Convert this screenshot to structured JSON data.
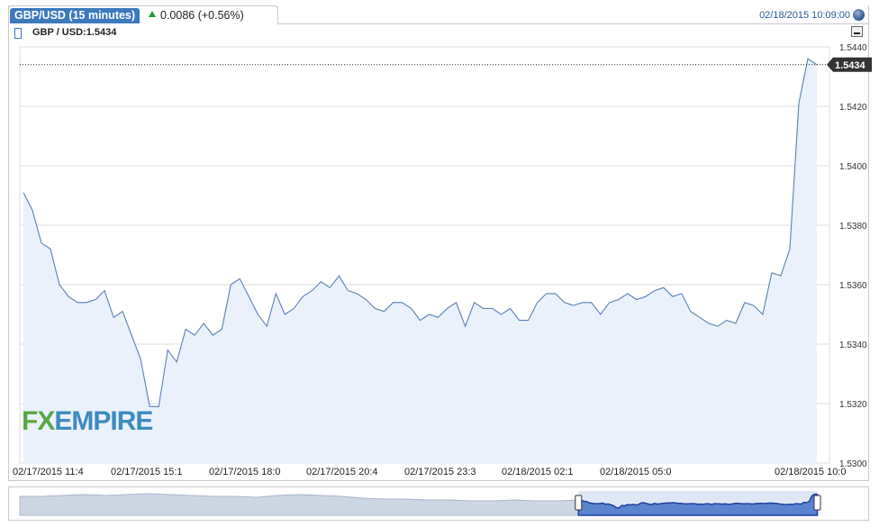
{
  "header": {
    "tab_title": "GBP/USD (15 minutes)",
    "change": "0.0086 (+0.56%)",
    "timestamp": "02/18/2015 10:09:00"
  },
  "legend": {
    "label": "GBP / USD:1.5434"
  },
  "brand": {
    "logo_text": "FXEMPIRE"
  },
  "colors": {
    "accent": "#3c79bd",
    "line": "#5a80b5",
    "fill": "#eaf1fb",
    "up": "#1f9a38",
    "logo_green": "#5aa647",
    "logo_blue": "#3d8bbf"
  },
  "chart_data": {
    "type": "area",
    "title": "",
    "current_price_label": "1.5434",
    "ylim": [
      1.53,
      1.544
    ],
    "yticks": [
      "1.5440",
      "1.5420",
      "1.5400",
      "1.5380",
      "1.5360",
      "1.5340",
      "1.5320",
      "1.5300"
    ],
    "xticks": [
      "02/17/2015 11:4",
      "02/17/2015 15:1",
      "02/17/2015 18:0",
      "02/17/2015 20:4",
      "02/17/2015 23:3",
      "02/18/2015 02:1",
      "02/18/2015 05:0",
      "02/18/2015 10:0"
    ],
    "series": [
      {
        "values": [
          1.5391,
          1.5385,
          1.5374,
          1.5372,
          1.536,
          1.5356,
          1.5354,
          1.5354,
          1.5355,
          1.5358,
          1.5349,
          1.5351,
          1.5343,
          1.5335,
          1.5319,
          1.5319,
          1.5338,
          1.5334,
          1.5345,
          1.5343,
          1.5347,
          1.5343,
          1.5345,
          1.536,
          1.5362,
          1.5356,
          1.535,
          1.5346,
          1.5357,
          1.535,
          1.5352,
          1.5356,
          1.5358,
          1.5361,
          1.5359,
          1.5363,
          1.5358,
          1.5357,
          1.5355,
          1.5352,
          1.5351,
          1.5354,
          1.5354,
          1.5352,
          1.5348,
          1.535,
          1.5349,
          1.5352,
          1.5354,
          1.5346,
          1.5354,
          1.5352,
          1.5352,
          1.535,
          1.5352,
          1.5348,
          1.5348,
          1.5354,
          1.5357,
          1.5357,
          1.5354,
          1.5353,
          1.5354,
          1.5354,
          1.535,
          1.5354,
          1.5355,
          1.5357,
          1.5355,
          1.5356,
          1.5358,
          1.5359,
          1.5356,
          1.5357,
          1.5351,
          1.5349,
          1.5347,
          1.5346,
          1.5348,
          1.5347,
          1.5354,
          1.5353,
          1.535,
          1.5364,
          1.5363,
          1.5372,
          1.5421,
          1.5436,
          1.5434
        ]
      }
    ]
  },
  "navigator": {
    "window_start": 0.69,
    "window_end": 0.985
  }
}
